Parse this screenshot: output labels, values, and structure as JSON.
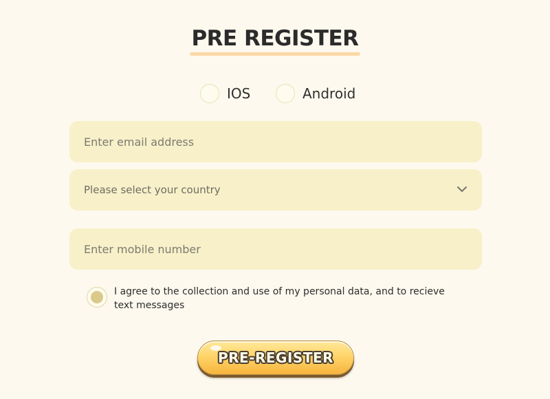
{
  "header": {
    "title": "PRE REGISTER"
  },
  "platforms": {
    "ios_label": "IOS",
    "android_label": "Android"
  },
  "form": {
    "email_placeholder": "Enter email address",
    "country_placeholder": "Please select your country",
    "mobile_placeholder": "Enter mobile number",
    "consent_text": "I agree to the collection and use of my personal data, and to recieve text messages",
    "consent_checked": true
  },
  "cta": {
    "label": "PRE-REGISTER"
  },
  "icons": {
    "dropdown": "chevron-down-icon"
  },
  "colors": {
    "background": "#fdf9ee",
    "field_bg": "#f8f0c9",
    "accent_underline": "#fbd8a6",
    "button_top": "#ffe89a",
    "button_bottom": "#f6b43d"
  }
}
